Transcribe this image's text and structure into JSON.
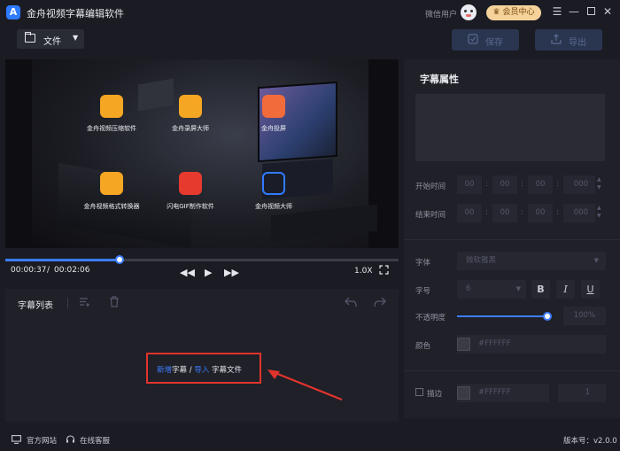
{
  "app": {
    "title": "金舟视频字幕编辑软件",
    "user_name": "微信用户",
    "vip_label": "会员中心"
  },
  "toolbar": {
    "file_label": "文件",
    "save_label": "保存",
    "export_label": "导出"
  },
  "video": {
    "overlay_apps": [
      {
        "label": "金舟视频压缩软件",
        "icon": "compress-app-icon",
        "color": "#f5a623"
      },
      {
        "label": "金舟录屏大师",
        "icon": "screen-record-app-icon",
        "color": "#f5a623"
      },
      {
        "label": "金舟投屏",
        "icon": "cast-app-icon",
        "color": "#f26b3a"
      },
      {
        "label": "金舟视频格式转换器",
        "icon": "convert-app-icon",
        "color": "#f5a623"
      },
      {
        "label": "闪电GIF制作软件",
        "icon": "gif-app-icon",
        "color": "#e63a2e"
      },
      {
        "label": "金舟视频大师",
        "icon": "video-master-app-icon",
        "color": "#2f7bff"
      }
    ]
  },
  "player": {
    "current_time": "00:00:37",
    "separator": "/",
    "total_time": "00:02:06",
    "progress": 0.29,
    "speed": "1.0X"
  },
  "subtitle_list": {
    "title": "字幕列表",
    "hint": {
      "add_link": "新增",
      "add_text": "字幕",
      "sep": "/",
      "import_link": "导入",
      "import_text": "字幕文件"
    }
  },
  "properties": {
    "title": "字幕属性",
    "start_time_label": "开始时间",
    "end_time_label": "结束时间",
    "start": {
      "hh": "00",
      "mm": "00",
      "ss": "00",
      "ms": "000"
    },
    "end": {
      "hh": "00",
      "mm": "00",
      "ss": "00",
      "ms": "000"
    },
    "font_label": "字体",
    "font_value": "微软雅黑",
    "size_label": "字号",
    "size_value": "6",
    "opacity_label": "不透明度",
    "opacity_value": "100%",
    "color_label": "颜色",
    "color_value": "#FFFFFF",
    "stroke_label": "描边",
    "stroke_color": "#FFFFFF",
    "stroke_width": "1"
  },
  "statusbar": {
    "website": "官方网站",
    "support": "在线客服",
    "version_label": "版本号：v2.0.0"
  },
  "colors": {
    "accent": "#3d7dff",
    "highlight": "#e0342d",
    "vip": "#f4d29a"
  }
}
